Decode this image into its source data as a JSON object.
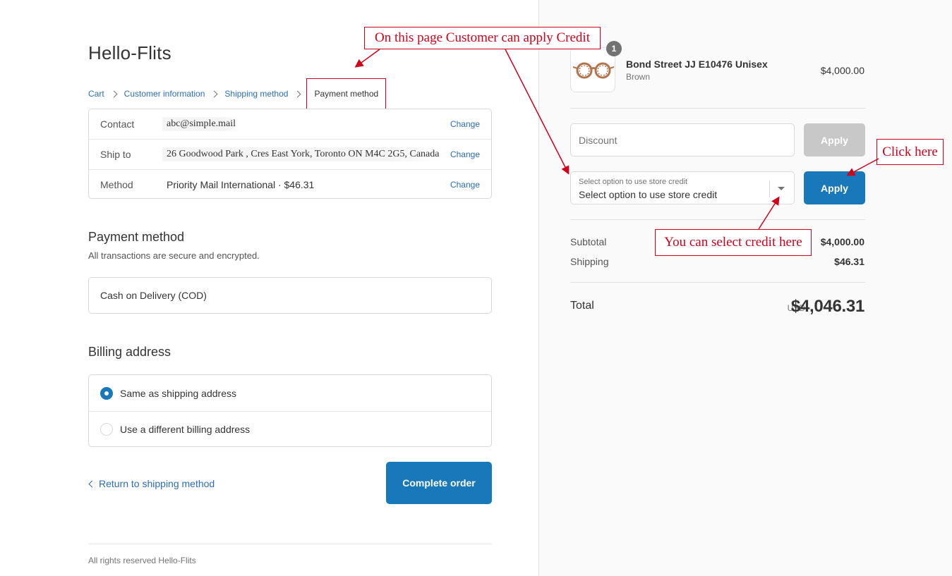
{
  "shop": {
    "title": "Hello-Flits"
  },
  "breadcrumb": {
    "items": [
      "Cart",
      "Customer information",
      "Shipping method"
    ],
    "current": "Payment method"
  },
  "review": {
    "contact": {
      "label": "Contact",
      "value": "abc@simple.mail",
      "change": "Change"
    },
    "ship_to": {
      "label": "Ship to",
      "value": "26 Goodwood Park , Cres East York, Toronto ON M4C 2G5, Canada",
      "change": "Change"
    },
    "method": {
      "label": "Method",
      "value": "Priority Mail International · $46.31",
      "change": "Change"
    }
  },
  "payment": {
    "title": "Payment method",
    "subtitle": "All transactions are secure and encrypted.",
    "option": "Cash on Delivery (COD)"
  },
  "billing": {
    "title": "Billing address",
    "options": [
      "Same as shipping address",
      "Use a different billing address"
    ]
  },
  "actions": {
    "return_label": "Return to shipping method",
    "complete_label": "Complete order"
  },
  "footer": {
    "text": "All rights reserved Hello-Flits"
  },
  "order": {
    "product": {
      "name": "Bond Street JJ E10476 Unisex",
      "variant": "Brown",
      "price": "$4,000.00",
      "quantity": "1"
    },
    "discount": {
      "placeholder": "Discount",
      "apply_label": "Apply"
    },
    "credit": {
      "label": "Select option to use store credit",
      "value": "Select option to use store credit",
      "apply_label": "Apply"
    },
    "summary": {
      "subtotal_label": "Subtotal",
      "subtotal_value": "$4,000.00",
      "shipping_label": "Shipping",
      "shipping_value": "$46.31",
      "total_label": "Total",
      "currency": "USD",
      "total_value": "$4,046.31"
    }
  },
  "annotations": {
    "top": "On this page Customer can apply Credit",
    "click": "Click here",
    "select": "You can select credit here"
  },
  "colors": {
    "accent": "#1878b9",
    "link": "#2a6ebb",
    "annotation": "#d0021b"
  },
  "icons": {
    "breadcrumb_separator": "chevron-right-icon",
    "return": "chevron-left-icon",
    "select_caret": "caret-down-icon",
    "product": "glasses-icon"
  }
}
